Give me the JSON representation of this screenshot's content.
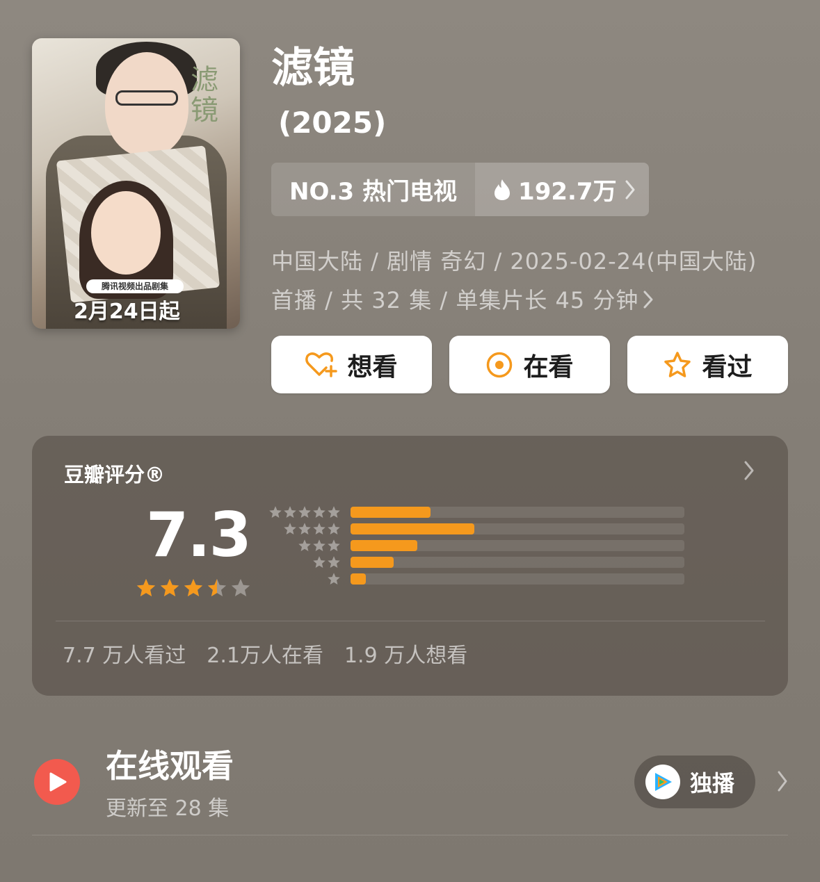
{
  "poster": {
    "title_art": "滤镜",
    "credit": "腾讯视频出品剧集",
    "date": "2月24日起"
  },
  "title": "滤镜",
  "year": "(2025)",
  "rank": {
    "label": "NO.3 热门电视",
    "heat": "192.7万"
  },
  "meta": {
    "line": "中国大陆 / 剧情 奇幻 / 2025-02-24(中国大陆) 首播 / 共 32 集 / 单集片长 45 分钟"
  },
  "actions": [
    {
      "label": "想看",
      "icon": "heart-plus-icon"
    },
    {
      "label": "在看",
      "icon": "target-icon"
    },
    {
      "label": "看过",
      "icon": "star-outline-icon"
    }
  ],
  "rating": {
    "title": "豆瓣评分®",
    "score": "7.3",
    "star_value": 3.5,
    "distribution": [
      {
        "stars": 5,
        "fraction": 0.24
      },
      {
        "stars": 4,
        "fraction": 0.37
      },
      {
        "stars": 3,
        "fraction": 0.2
      },
      {
        "stars": 2,
        "fraction": 0.13
      },
      {
        "stars": 1,
        "fraction": 0.045
      }
    ],
    "counts": [
      "7.7 万人看过",
      "2.1万人在看",
      "1.9 万人想看"
    ]
  },
  "watch": {
    "title": "在线观看",
    "subtitle": "更新至 28 集",
    "exclusive": "独播"
  },
  "colors": {
    "accent_orange": "#f5991d",
    "play_red": "#f25a4e"
  }
}
